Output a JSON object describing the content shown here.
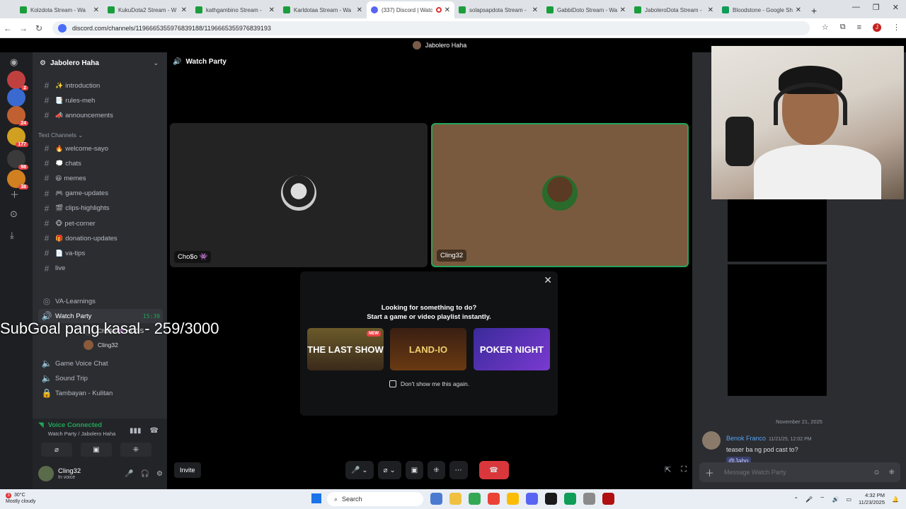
{
  "browser": {
    "tabs": [
      {
        "label": "Kolzdota Stream - Wa",
        "icon": "kick-icon"
      },
      {
        "label": "KukuDota2 Stream - W",
        "icon": "kick-icon"
      },
      {
        "label": "kathgambino Stream -",
        "icon": "kick-icon"
      },
      {
        "label": "Karldotaa Stream - Wa",
        "icon": "kick-icon"
      },
      {
        "label": "(337) Discord | Watc",
        "icon": "discord-icon",
        "active": true
      },
      {
        "label": "solapsapdota Stream -",
        "icon": "kick-icon"
      },
      {
        "label": "GabbiDoto Stream - Wa",
        "icon": "kick-icon"
      },
      {
        "label": "JaboleroDota Stream -",
        "icon": "kick-icon"
      },
      {
        "label": "Bloodstone - Google Sh",
        "icon": "sheets-icon"
      }
    ],
    "url": "discord.com/channels/1196665355976839188/1196665355976839193"
  },
  "discord": {
    "top_user": "Jabolero Haha",
    "server_name": "Jabolero Haha",
    "servers": [
      {
        "badge": "2"
      },
      {
        "badge": ""
      },
      {
        "badge": "24"
      },
      {
        "badge": "177"
      },
      {
        "badge": "98"
      },
      {
        "badge": "38"
      }
    ],
    "channels_top": [
      {
        "emoji": "✨",
        "name": "introduction"
      },
      {
        "emoji": "📑",
        "name": "rules-meh"
      },
      {
        "emoji": "📣",
        "name": "announcements"
      }
    ],
    "text_category": "Text Channels",
    "text_channels": [
      {
        "emoji": "🔥",
        "name": "welcome-sayo"
      },
      {
        "emoji": "💭",
        "name": "chats"
      },
      {
        "emoji": "😆",
        "name": "memes"
      },
      {
        "emoji": "🎮",
        "name": "game-updates"
      },
      {
        "emoji": "🎬",
        "name": "clips-highlights"
      },
      {
        "emoji": "🐵",
        "name": "pet-corner"
      },
      {
        "emoji": "🎁",
        "name": "donation-updates"
      },
      {
        "emoji": "📄",
        "name": "va-tips"
      },
      {
        "emoji": "",
        "name": "live"
      }
    ],
    "voice_channels": {
      "va_learnings": "VA-Learnings",
      "watch_party": "Watch Party",
      "watch_party_time": "15:39",
      "members": [
        {
          "name": "Cho$o 👾 ⚡OGS"
        },
        {
          "name": "Cling32"
        }
      ],
      "game_voice": "Game Voice Chat",
      "sound_trip": "Sound Trip",
      "tambayan": "Tambayan - Kulitan"
    },
    "voice_status": {
      "title": "Voice Connected",
      "subtitle": "Watch Party / Jabolero Haha"
    },
    "user": {
      "name": "Cling32",
      "status": "In voice"
    },
    "stage": {
      "title": "Watch Party",
      "tiles": [
        {
          "name": "Cho$o 👾"
        },
        {
          "name": "Cling32"
        }
      ],
      "activity": {
        "line1": "Looking for something to do?",
        "line2": "Start a game or video playlist instantly.",
        "games": [
          "THE LAST SHOW",
          "LAND-IO",
          "POKER NIGHT"
        ],
        "new_badge": "NEW",
        "dont_show": "Don't show me this again."
      },
      "invite": "Invite"
    },
    "chat": {
      "date": "November 21, 2025",
      "message": {
        "author": "Benok Franco",
        "timestamp": "11/21/25, 12:02 PM",
        "text": "teaser ba ng pod cast to?",
        "mention": "@Jabo"
      },
      "placeholder": "Message Watch Party"
    }
  },
  "overlay": {
    "subgoal": "SubGoal pang kasal - 259/3000"
  },
  "taskbar": {
    "weather_temp": "30°C",
    "weather_desc": "Mostly cloudy",
    "weather_badge": "3",
    "search": "Search",
    "time": "4:32 PM",
    "date": "11/23/2025"
  }
}
